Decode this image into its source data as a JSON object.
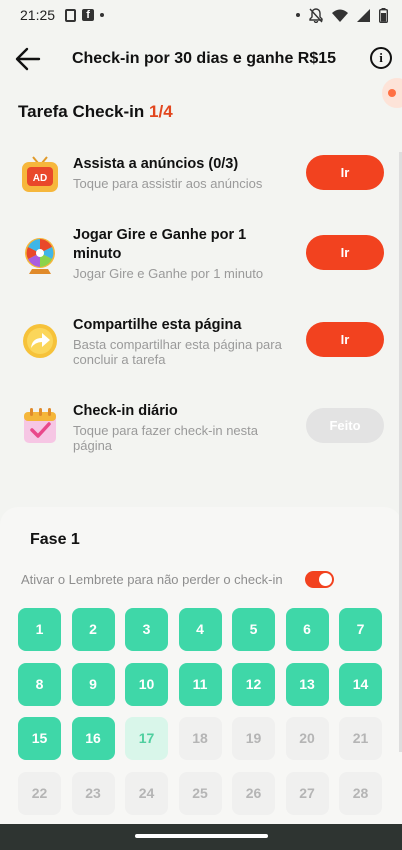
{
  "status_bar": {
    "time": "21:25"
  },
  "header": {
    "title": "Check-in por 30 dias e ganhe R$15",
    "info_label": "i"
  },
  "tasks_section": {
    "heading": "Tarefa Check-in",
    "progress": "1/4",
    "tasks": [
      {
        "name": "Assista a anúncios  (0/3)",
        "desc": "Toque para assistir aos anúncios",
        "button": "Ir",
        "icon": "ad-tv-icon",
        "done": false
      },
      {
        "name": "Jogar Gire e Ganhe por 1 minuto",
        "desc": "Jogar Gire e Ganhe por 1 minuto",
        "button": "Ir",
        "icon": "spin-wheel-icon",
        "done": false
      },
      {
        "name": "Compartilhe esta página",
        "desc": "Basta compartilhar esta página para concluir a tarefa",
        "button": "Ir",
        "icon": "share-arrow-icon",
        "done": false
      },
      {
        "name": "Check-in diário",
        "desc": "Toque para fazer check-in nesta página",
        "button": "Feito",
        "icon": "calendar-check-icon",
        "done": true
      }
    ]
  },
  "phase": {
    "title": "Fase 1",
    "reminder_label": "Ativar o Lembrete para não perder o check-in",
    "reminder_on": true,
    "days": [
      "1",
      "2",
      "3",
      "4",
      "5",
      "6",
      "7",
      "8",
      "9",
      "10",
      "11",
      "12",
      "13",
      "14",
      "15",
      "16",
      "17",
      "18",
      "19",
      "20",
      "21",
      "22",
      "23",
      "24",
      "25",
      "26",
      "27",
      "28"
    ],
    "checked_through": 16,
    "today": 17
  },
  "colors": {
    "accent": "#f2421f",
    "checked": "#3fd7a8",
    "today_bg": "#d9f6ea"
  }
}
